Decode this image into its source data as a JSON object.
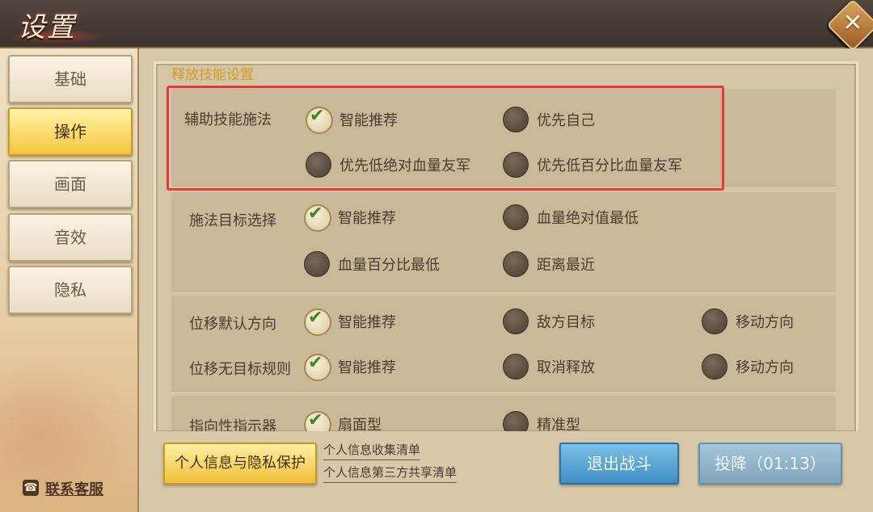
{
  "window": {
    "title": "设置",
    "close_symbol": "✕"
  },
  "sidebar": {
    "tabs": [
      {
        "label": "基础",
        "active": false
      },
      {
        "label": "操作",
        "active": true
      },
      {
        "label": "画面",
        "active": false
      },
      {
        "label": "音效",
        "active": false
      },
      {
        "label": "隐私",
        "active": false
      }
    ],
    "contact": {
      "label": "联系客服",
      "icon": "phone-icon"
    }
  },
  "main": {
    "section_title": "释放技能设置",
    "rows": [
      {
        "label": "辅助技能施法",
        "options": [
          {
            "label": "智能推荐",
            "checked": true
          },
          {
            "label": "优先自己",
            "checked": false
          },
          {
            "label": "优先低绝对血量友军",
            "checked": false
          },
          {
            "label": "优先低百分比血量友军",
            "checked": false
          }
        ]
      },
      {
        "label": "施法目标选择",
        "options": [
          {
            "label": "智能推荐",
            "checked": true
          },
          {
            "label": "血量绝对值最低",
            "checked": false
          },
          {
            "label": "血量百分比最低",
            "checked": false
          },
          {
            "label": "距离最近",
            "checked": false
          }
        ]
      },
      {
        "label": "位移默认方向",
        "options": [
          {
            "label": "智能推荐",
            "checked": true
          },
          {
            "label": "敌方目标",
            "checked": false
          },
          {
            "label": "移动方向",
            "checked": false
          }
        ]
      },
      {
        "label": "位移无目标规则",
        "options": [
          {
            "label": "智能推荐",
            "checked": true
          },
          {
            "label": "取消释放",
            "checked": false
          },
          {
            "label": "移动方向",
            "checked": false
          }
        ]
      },
      {
        "label": "指向性指示器",
        "options": [
          {
            "label": "扇面型",
            "checked": true
          },
          {
            "label": "精准型",
            "checked": false
          }
        ]
      }
    ]
  },
  "footer": {
    "privacy_button": "个人信息与隐私保护",
    "links": [
      "个人信息收集清单",
      "个人信息第三方共享清单"
    ],
    "exit_button": "退出战斗",
    "surrender_button": "投降（01:13）"
  },
  "colors": {
    "highlight_border": "#e63a3a",
    "active_tab": "#f4c53c",
    "exit_button": "#3f8fc4"
  }
}
